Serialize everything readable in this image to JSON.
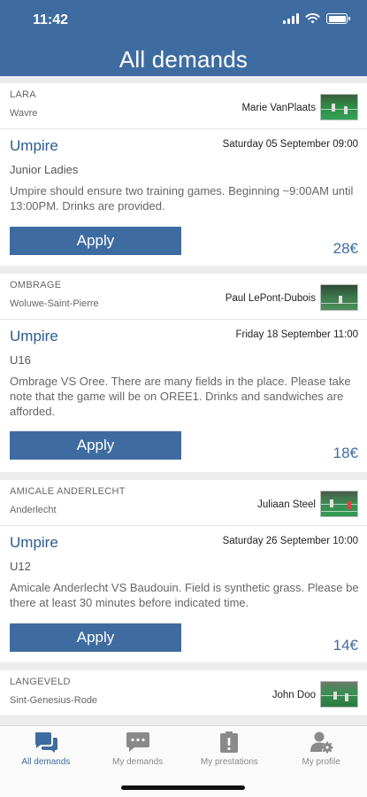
{
  "status_bar": {
    "time": "11:42"
  },
  "header": {
    "title": "All demands"
  },
  "demands": [
    {
      "club": "LARA",
      "city": "Wavre",
      "user": "Marie VanPlaats",
      "role": "Umpire",
      "date": "Saturday 05 September 09:00",
      "category": "Junior Ladies",
      "description": "Umpire should ensure two training games. Beginning ~9:00AM until 13:00PM. Drinks are provided.",
      "apply_label": "Apply",
      "price": "28€"
    },
    {
      "club": "OMBRAGE",
      "city": "Woluwe-Saint-Pierre",
      "user": "Paul LePont-Dubois",
      "role": "Umpire",
      "date": "Friday 18 September 11:00",
      "category": "U16",
      "description": "Ombrage VS Oree. There are many fields in the place. Please take note that the game will be on OREE1. Drinks and sandwiches are afforded.",
      "apply_label": "Apply",
      "price": "18€"
    },
    {
      "club": "AMICALE ANDERLECHT",
      "city": "Anderlecht",
      "user": "Juliaan Steel",
      "role": "Umpire",
      "date": "Saturday 26 September 10:00",
      "category": "U12",
      "description": "Amicale Anderlecht VS Baudouin. Field is synthetic grass. Please be there at least 30 minutes before indicated time.",
      "apply_label": "Apply",
      "price": "14€"
    },
    {
      "club": "LANGEVELD",
      "city": "Sint-Genesius-Rode",
      "user": "John Doo"
    }
  ],
  "tabbar": {
    "items": [
      {
        "label": "All demands",
        "icon": "chat-bubbles-icon",
        "active": true
      },
      {
        "label": "My demands",
        "icon": "chat-bubble-icon",
        "active": false
      },
      {
        "label": "My prestations",
        "icon": "clipboard-alert-icon",
        "active": false
      },
      {
        "label": "My profile",
        "icon": "user-gear-icon",
        "active": false
      }
    ]
  },
  "colors": {
    "primary": "#3f6ca0",
    "accent_text": "#2d5b91",
    "background": "#ececec",
    "tab_inactive": "#8a8a8a"
  }
}
